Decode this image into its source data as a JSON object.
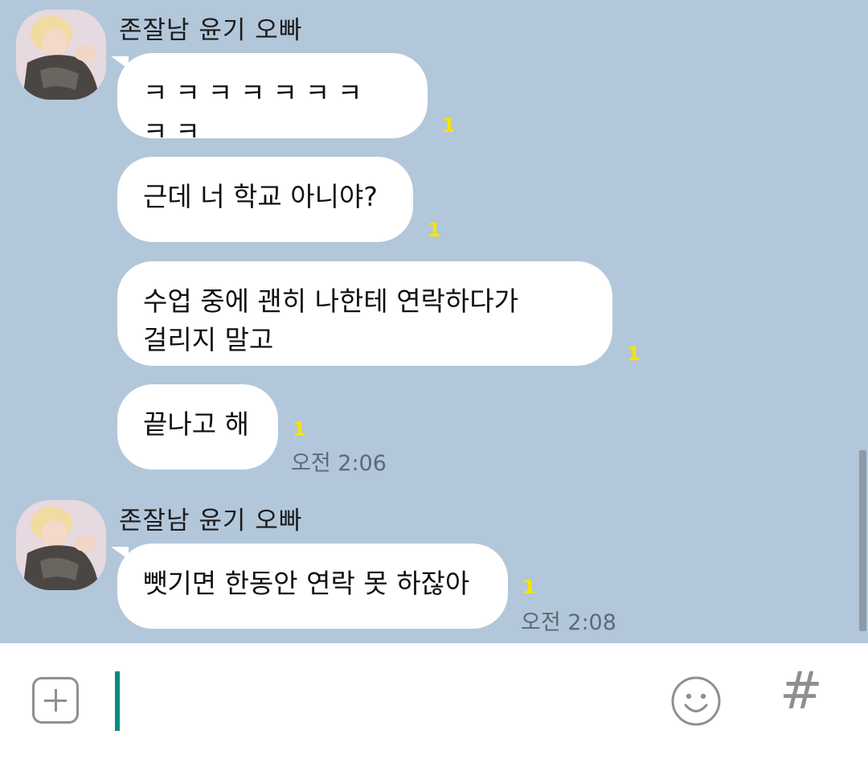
{
  "chat": {
    "groups": [
      {
        "sender": "존잘남 윤기 오빠",
        "messages": [
          {
            "text": "ㅋㅋㅋㅋㅋㅋㅋㅋㅋ",
            "unread": "1",
            "time": ""
          },
          {
            "text": "근데 너 학교 아니야?",
            "unread": "1",
            "time": ""
          },
          {
            "text": "수업 중에 괜히 나한테 연락하다가\n걸리지 말고",
            "unread": "1",
            "time": ""
          },
          {
            "text": "끝나고 해",
            "unread": "1",
            "time": "오전 2:06"
          }
        ]
      },
      {
        "sender": "존잘남 윤기 오빠",
        "messages": [
          {
            "text": "뺏기면 한동안 연락 못 하잖아",
            "unread": "1",
            "time": "오전 2:08"
          }
        ]
      }
    ]
  },
  "input_bar": {
    "placeholder": "",
    "value": "",
    "accent_color": "#008e7e",
    "icons": [
      "plus-icon",
      "emoji-icon",
      "hash-icon"
    ]
  },
  "colors": {
    "chat_background": "#b2c7da",
    "bubble": "#ffffff",
    "unread_badge": "#f5e400"
  }
}
